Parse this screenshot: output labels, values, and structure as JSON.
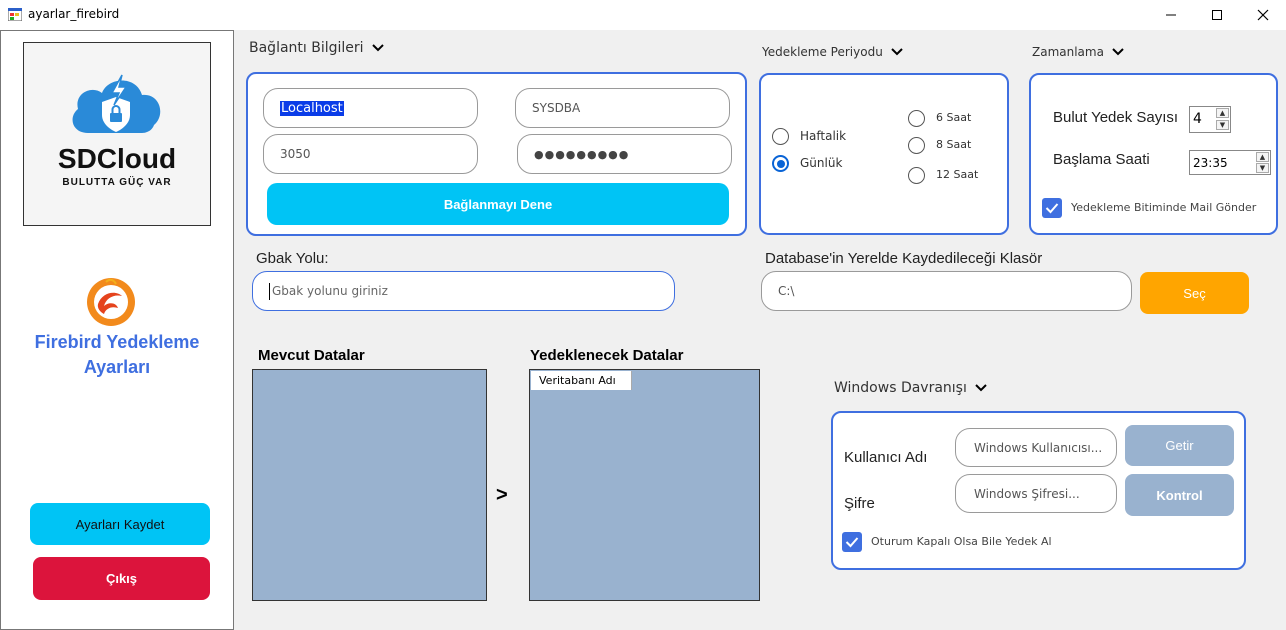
{
  "window": {
    "title": "ayarlar_firebird"
  },
  "sidebar": {
    "logo_brand": "SDCloud",
    "logo_tagline": "BULUTTA GÜÇ VAR",
    "title_line1": "Firebird Yedekleme",
    "title_line2": "Ayarları",
    "save_label": "Ayarları Kaydet",
    "exit_label": "Çıkış"
  },
  "connection": {
    "header": "Bağlantı Bilgileri",
    "host": "Localhost",
    "user": "SYSDBA",
    "port": "3050",
    "password_mask": "●●●●●●●●●",
    "test_label": "Bağlanmayı Dene"
  },
  "period": {
    "header": "Yedekleme Periyodu",
    "options": [
      "Haftalik",
      "Günlük",
      "6 Saat",
      "8 Saat",
      "12 Saat"
    ],
    "selected": "Günlük"
  },
  "schedule": {
    "header": "Zamanlama",
    "cloud_count_label": "Bulut Yedek Sayısı",
    "cloud_count_value": "4",
    "start_label": "Başlama Saati",
    "start_value": "23:35",
    "mail_label": "Yedekleme Bitiminde Mail Gönder",
    "mail_checked": true
  },
  "gbak": {
    "label": "Gbak Yolu:",
    "placeholder": "Gbak yolunu giriniz"
  },
  "local_folder": {
    "label": "Database'in Yerelde Kaydedileceği Klasör",
    "value": "C:\\",
    "select_label": "Seç"
  },
  "lists": {
    "current_label": "Mevcut Datalar",
    "backup_label": "Yedeklenecek Datalar",
    "backup_column": "Veritabanı Adı",
    "move_label": ">"
  },
  "windows": {
    "header": "Windows Davranışı",
    "user_label": "Kullanıcı Adı",
    "user_placeholder": "Windows Kullanıcısı...",
    "get_label": "Getir",
    "password_label": "Şifre",
    "password_placeholder": "Windows Şifresi...",
    "check_label": "Kontrol",
    "session_label": "Oturum Kapalı Olsa Bile Yedek Al",
    "session_checked": true
  },
  "colors": {
    "accent": "#3f6fe0",
    "cyan": "#00c4f5",
    "red": "#dc143c",
    "orange": "#ffa500",
    "panel": "#99b2cf",
    "disabled_button": "#99b2cf"
  }
}
